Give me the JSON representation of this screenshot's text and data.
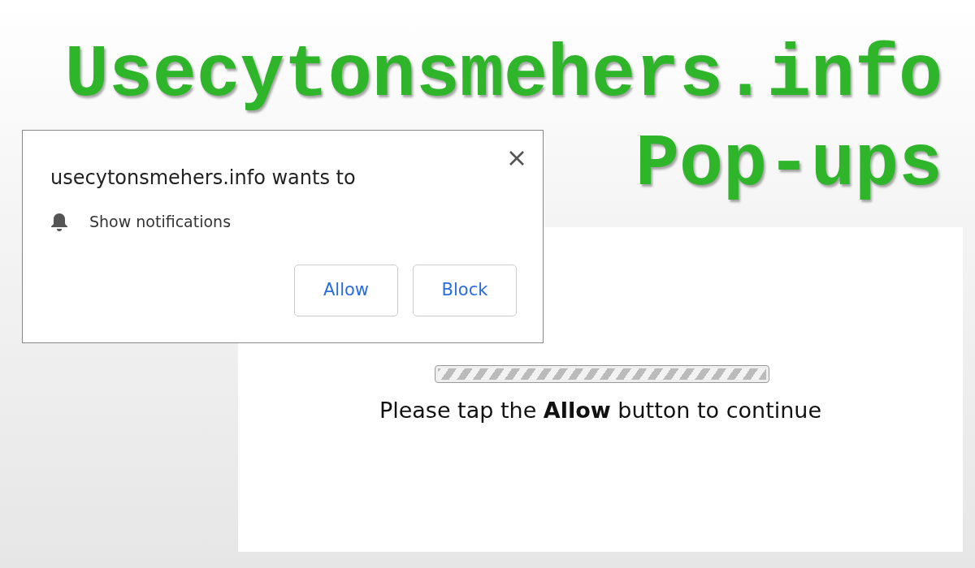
{
  "headline": [
    "Usecytonsmehers.info",
    "Pop-ups"
  ],
  "dialog": {
    "title": "usecytonsmehers.info wants to",
    "permission": "Show notifications",
    "buttons": [
      "Allow",
      "Block"
    ]
  },
  "page": {
    "progress": {
      "level": 1
    },
    "message": "Please tap the **Allow** button to continue"
  }
}
